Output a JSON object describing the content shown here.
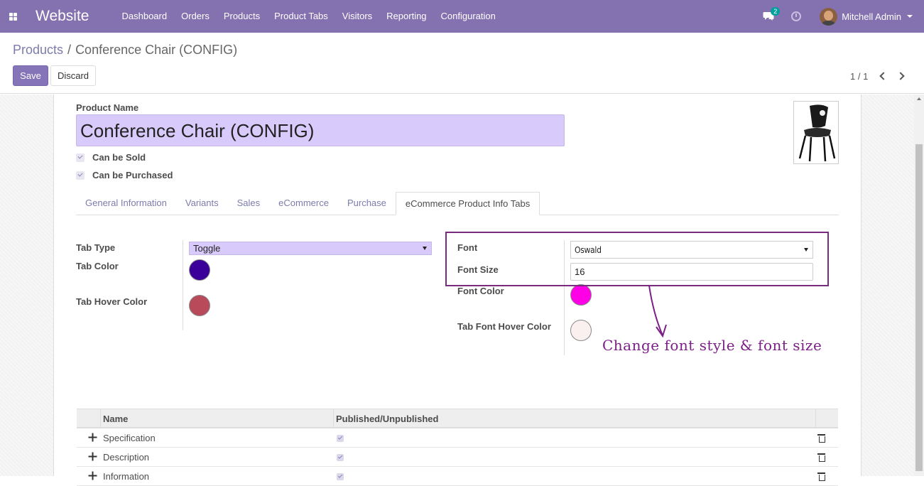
{
  "navbar": {
    "brand": "Website",
    "menu": [
      "Dashboard",
      "Orders",
      "Products",
      "Product Tabs",
      "Visitors",
      "Reporting",
      "Configuration"
    ],
    "chat_badge": "2",
    "user_name": "Mitchell Admin",
    "bg_color": "#8471b0"
  },
  "control_panel": {
    "breadcrumb_parent": "Products",
    "breadcrumb_sep": "/",
    "breadcrumb_current": "Conference Chair (CONFIG)",
    "save_label": "Save",
    "discard_label": "Discard",
    "pager": "1 / 1"
  },
  "form": {
    "product_name_label": "Product Name",
    "product_name_value": "Conference Chair (CONFIG)",
    "can_be_sold": "Can be Sold",
    "can_be_purchased": "Can be Purchased",
    "tabs": [
      "General Information",
      "Variants",
      "Sales",
      "eCommerce",
      "Purchase",
      "eCommerce Product Info Tabs"
    ],
    "active_tab": "eCommerce Product Info Tabs",
    "left_fields": {
      "tab_type_label": "Tab Type",
      "tab_type_value": "Toggle",
      "tab_color_label": "Tab Color",
      "tab_color": "#3a0099",
      "tab_hover_color_label": "Tab Hover Color",
      "tab_hover_color": "#b84a5a"
    },
    "right_fields": {
      "font_label": "Font",
      "font_value": "Oswald",
      "font_size_label": "Font Size",
      "font_size_value": "16",
      "font_color_label": "Font Color",
      "font_color": "#ff00e6",
      "tab_font_hover_color_label": "Tab Font Hover Color",
      "tab_font_hover_color": "#fbf0f0"
    }
  },
  "annotation": {
    "text": "Change font style & font size",
    "color": "#7b1f86"
  },
  "table": {
    "headers": [
      "Name",
      "Published/Unpublished"
    ],
    "rows": [
      {
        "name": "Specification",
        "published": true
      },
      {
        "name": "Description",
        "published": true
      },
      {
        "name": "Information",
        "published": true
      }
    ]
  }
}
